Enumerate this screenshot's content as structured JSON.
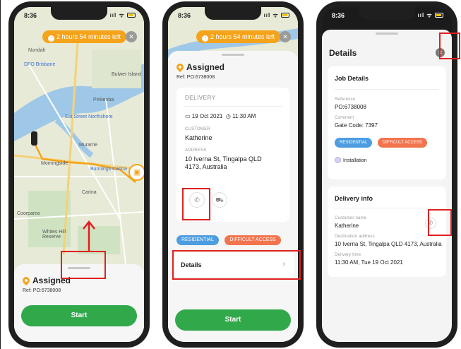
{
  "status": {
    "time": "8:36",
    "signal": "ııl ᯤ"
  },
  "eta_pill": {
    "text": "2 hours 54 minutes left"
  },
  "map": {
    "labels": [
      "Nundah",
      "DFO Brisbane",
      "Bulwer Island",
      "Pinkenba",
      "Eat Street Northshore",
      "Murarrie",
      "Morningside",
      "Bunnings Carina",
      "Carina",
      "Coorparoo",
      "Whites Hill Reserve"
    ]
  },
  "screen1": {
    "status": "Assigned",
    "ref": "Ref: PO:6738008",
    "start": "Start"
  },
  "screen2": {
    "status": "Assigned",
    "ref": "Ref: PO:6738008",
    "card_title": "DELIVERY",
    "date": "19 Oct 2021",
    "time": "11:30 AM",
    "customer_label": "CUSTOMER",
    "customer": "Katherine",
    "address_label": "ADDRESS",
    "address_line1": "10 Iverna St, Tingalpa QLD",
    "address_line2": "4173, Australia",
    "tags": [
      "RESIDENTIAL",
      "DIFFICULT ACCESS"
    ],
    "details": "Details",
    "start": "Start"
  },
  "screen3": {
    "title": "Details",
    "job_details": {
      "heading": "Job Details",
      "reference_label": "Reference",
      "reference": "PO:6738008",
      "comment_label": "Comment",
      "comment": "Gate Code: 7397",
      "tags": [
        "RESIDENTIAL",
        "DIFFICULT ACCESS"
      ],
      "service": "Installation"
    },
    "delivery_info": {
      "heading": "Delivery info",
      "customer_label": "Customer name",
      "customer": "Katherine",
      "address_label": "Destination address",
      "address": "10 Iverna St, Tingalpa QLD 4173, Australia",
      "time_label": "Delivery time",
      "time": "11:30 AM, Tue 19 Oct 2021"
    }
  },
  "colors": {
    "accent": "#f5a31a",
    "start_green": "#31a94b",
    "residential": "#4d9de0",
    "difficult": "#f2744e",
    "highlight": "#e02020"
  }
}
